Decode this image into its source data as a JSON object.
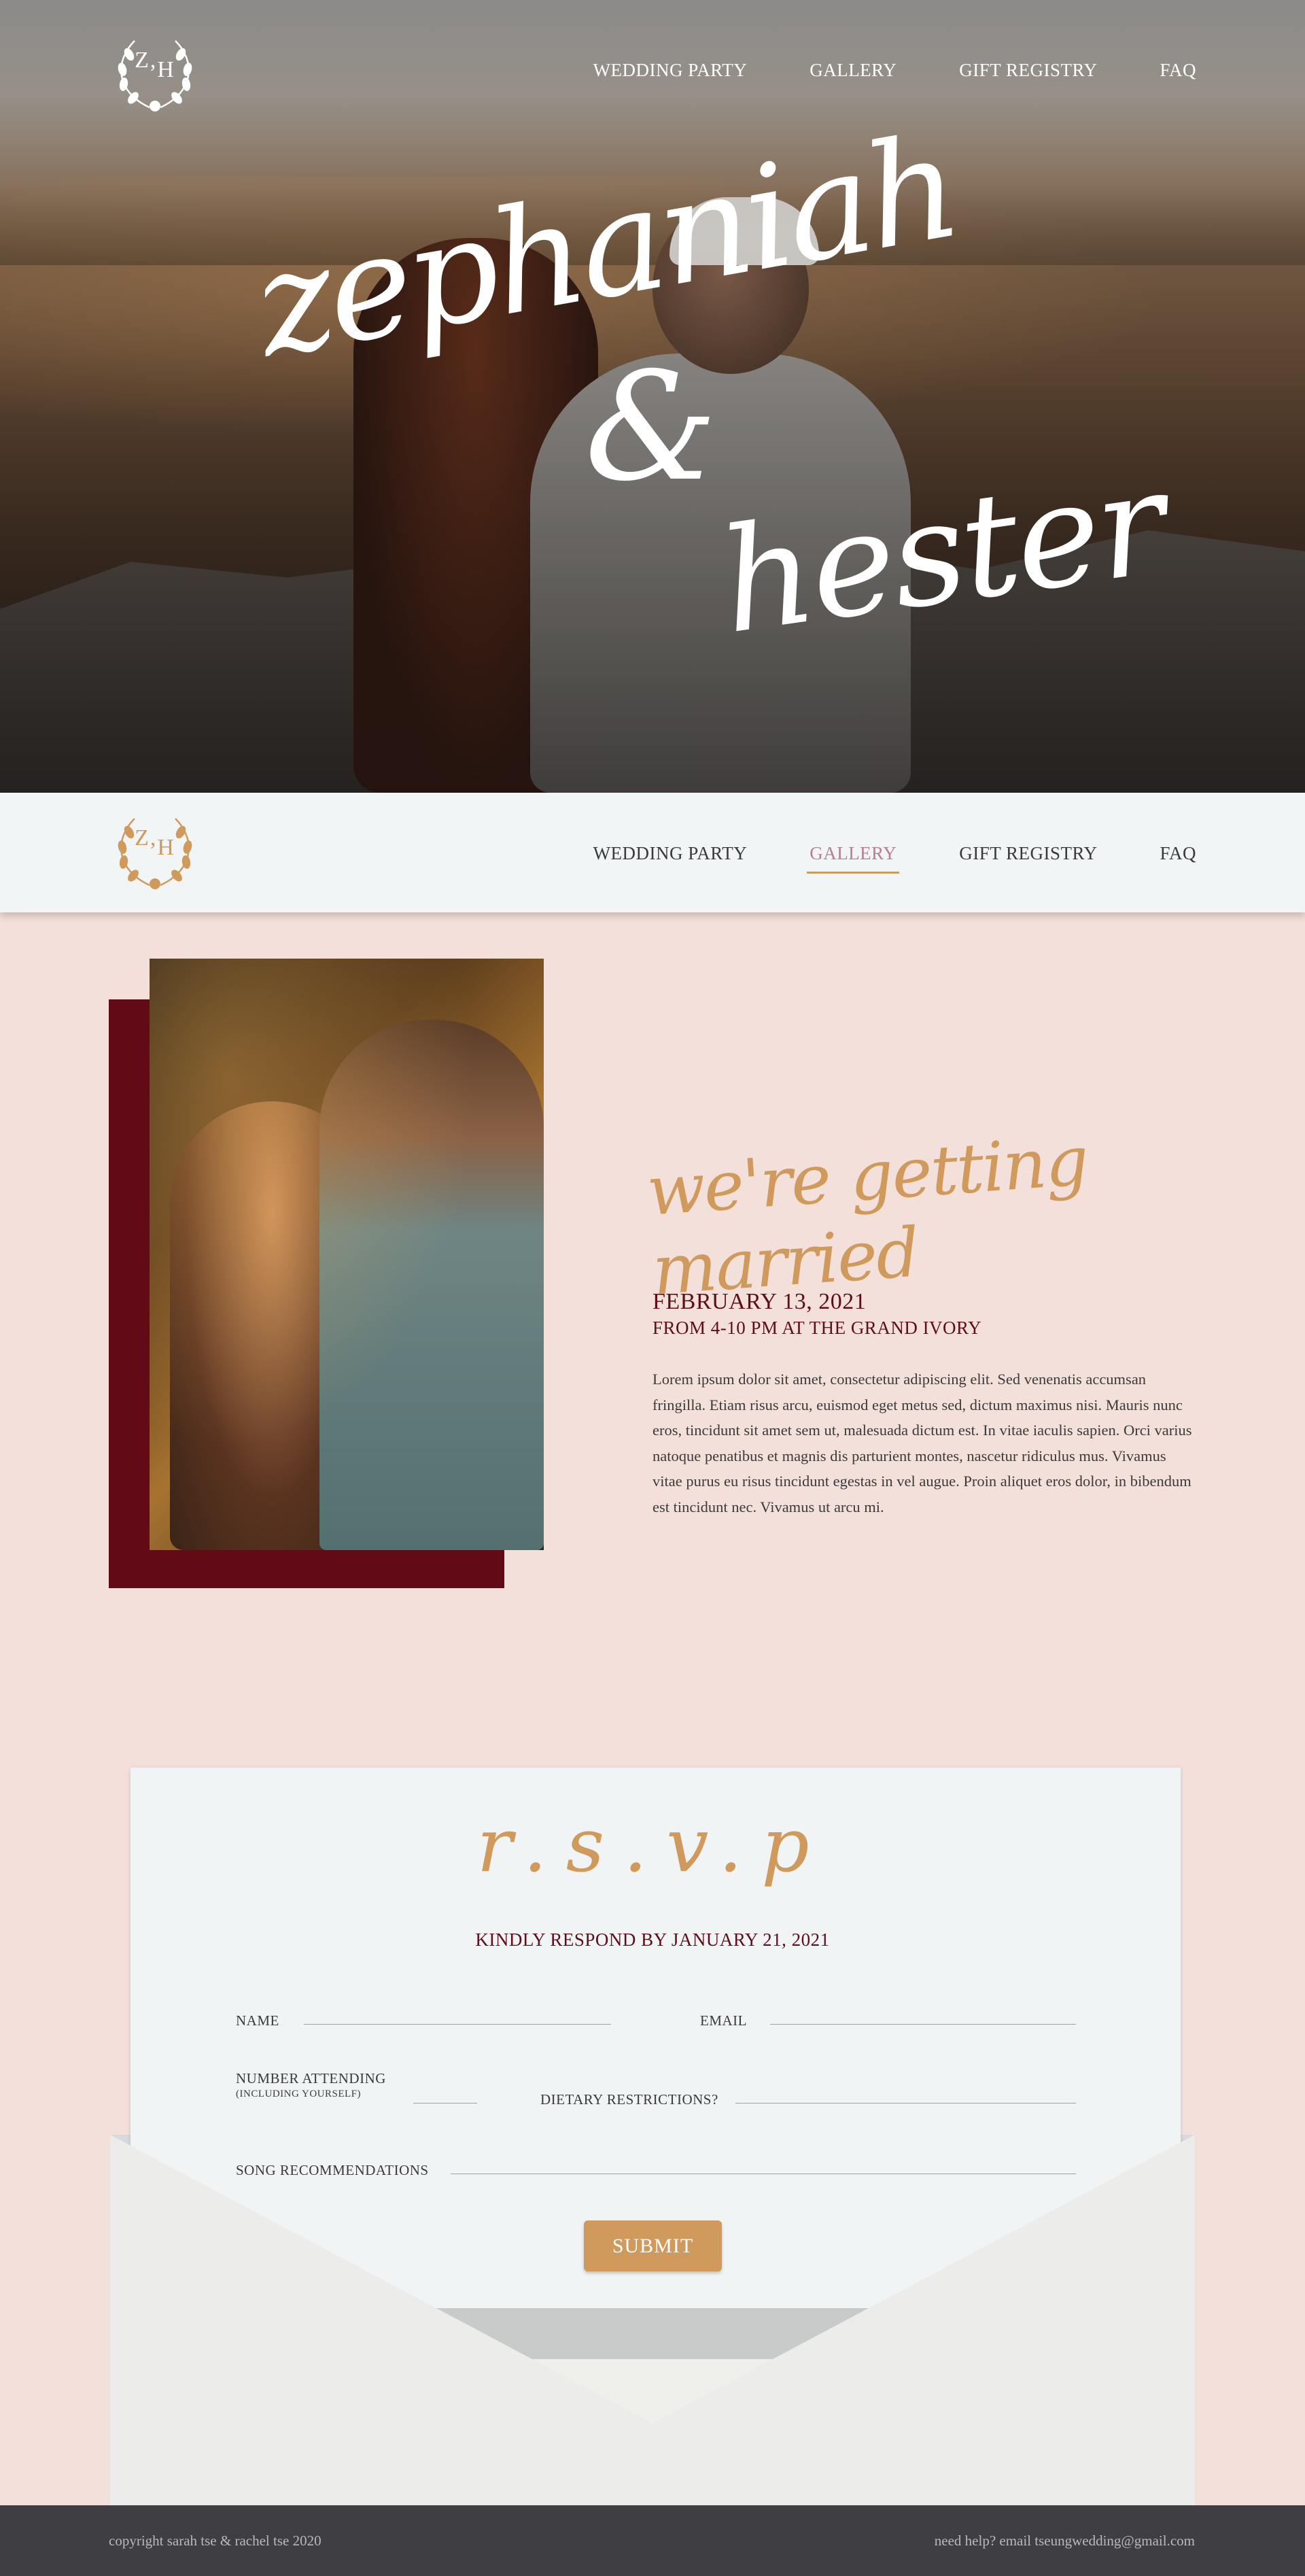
{
  "nav": {
    "logo_letters": [
      "Z",
      "H"
    ],
    "items": [
      {
        "label": "WEDDING PARTY"
      },
      {
        "label": "GALLERY"
      },
      {
        "label": "GIFT REGISTRY"
      },
      {
        "label": "FAQ"
      }
    ],
    "active": "GALLERY"
  },
  "hero": {
    "name1": "zephaniah",
    "amp": "&",
    "name2": "hester"
  },
  "intro": {
    "heading": "we're getting married",
    "date": "FEBRUARY 13, 2021",
    "venue": "FROM 4-10 PM AT THE GRAND IVORY",
    "body": "Lorem ipsum dolor sit amet, consectetur adipiscing elit. Sed venenatis accumsan fringilla. Etiam risus arcu, euismod eget metus sed, dictum maximus nisi. Mauris nunc eros, tincidunt sit amet sem ut, malesuada dictum est. In vitae iaculis sapien. Orci varius natoque penatibus et magnis dis parturient montes, nascetur ridiculus mus. Vivamus vitae purus eu risus tincidunt egestas in vel augue. Proin aliquet eros dolor, in bibendum est tincidunt nec. Vivamus ut arcu mi."
  },
  "rsvp": {
    "title": "r.s.v.p",
    "respond_by": "KINDLY RESPOND BY JANUARY 21, 2021",
    "fields": {
      "name": "NAME",
      "email": "EMAIL",
      "number_attending": "NUMBER ATTENDING",
      "number_attending_note": "(INCLUDING YOURSELF)",
      "dietary": "DIETARY RESTRICTIONS?",
      "songs": "SONG RECOMMENDATIONS"
    },
    "submit": "SUBMIT"
  },
  "footer": {
    "copyright": "copyright sarah tse & rachel tse 2020",
    "help": "need help? email tseungwedding@gmail.com"
  },
  "colors": {
    "accent_gold": "#cf9a5c",
    "burgundy": "#620a16",
    "page_bg": "#f4e0da",
    "footer_bg": "#3f3f43"
  }
}
